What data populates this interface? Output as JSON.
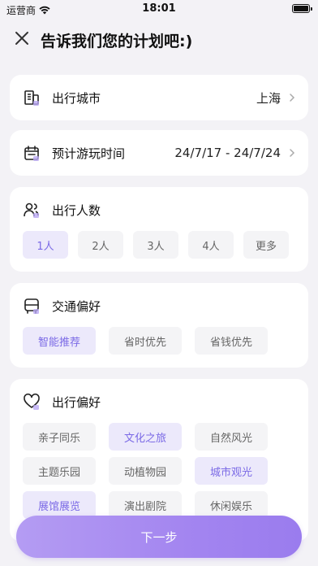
{
  "status_bar": {
    "carrier": "运营商",
    "time": "18:01"
  },
  "header": {
    "title": "告诉我们您的计划吧:)"
  },
  "city": {
    "label": "出行城市",
    "value": "上海"
  },
  "dates": {
    "label": "预计游玩时间",
    "value": "24/7/17 - 24/7/24"
  },
  "people": {
    "label": "出行人数",
    "options": [
      "1人",
      "2人",
      "3人",
      "4人",
      "更多"
    ],
    "selected": "1人"
  },
  "transport": {
    "label": "交通偏好",
    "options": [
      "智能推荐",
      "省时优先",
      "省钱优先"
    ],
    "selected": "智能推荐"
  },
  "travel_pref": {
    "label": "出行偏好",
    "options": [
      "亲子同乐",
      "文化之旅",
      "自然风光",
      "主题乐园",
      "动植物园",
      "城市观光",
      "展馆展览",
      "演出剧院",
      "休闲娱乐"
    ],
    "selected": [
      "文化之旅",
      "城市观光",
      "展馆展览"
    ]
  },
  "next_button": "下一步",
  "colors": {
    "accent": "#7b6ae6",
    "chip_selected_bg": "#ece9fb",
    "button": "#a385f0"
  }
}
